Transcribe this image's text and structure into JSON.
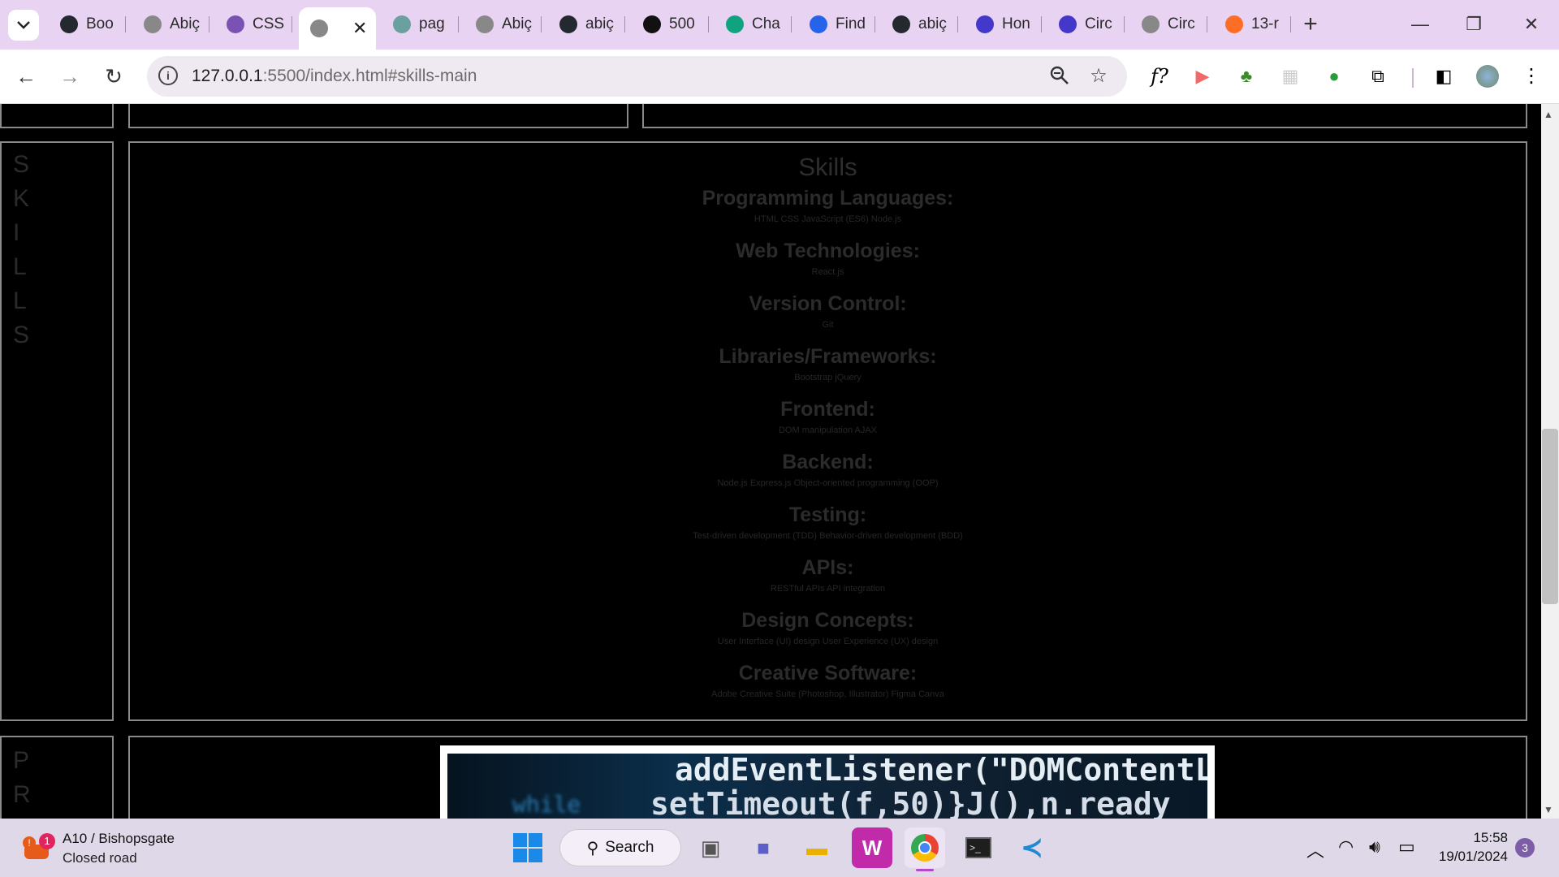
{
  "browser": {
    "tabs": [
      {
        "label": "Boo",
        "icon": "github-icon",
        "color": "#24292f"
      },
      {
        "label": "Abiç",
        "icon": "globe-icon",
        "color": "#888888"
      },
      {
        "label": "CSS",
        "icon": "bootstrap-icon",
        "color": "#7952b3"
      },
      {
        "label": "",
        "icon": "globe-icon",
        "color": "#888888",
        "active": true
      },
      {
        "label": "pag",
        "icon": "loading-icon",
        "color": "#6aa0a0"
      },
      {
        "label": "Abiç",
        "icon": "globe-icon",
        "color": "#888888"
      },
      {
        "label": "abiç",
        "icon": "github-icon",
        "color": "#24292f"
      },
      {
        "label": "500",
        "icon": "unsplash-icon",
        "color": "#111111"
      },
      {
        "label": "Cha",
        "icon": "chatgpt-icon",
        "color": "#10a37f"
      },
      {
        "label": "Find",
        "icon": "flag-icon",
        "color": "#2563eb"
      },
      {
        "label": "abiç",
        "icon": "github-icon",
        "color": "#24292f"
      },
      {
        "label": "Hon",
        "icon": "circle-c-icon",
        "color": "#4338ca"
      },
      {
        "label": "Circ",
        "icon": "circle-c-icon",
        "color": "#4338ca"
      },
      {
        "label": "Circ",
        "icon": "globe-icon",
        "color": "#888888"
      },
      {
        "label": "13-r",
        "icon": "gitlab-icon",
        "color": "#fc6d26"
      }
    ],
    "url_host": "127.0.0.1",
    "url_rest": ":5500/index.html#skills-main"
  },
  "page": {
    "side_letters_top": [
      "S",
      "K",
      "I",
      "L",
      "L",
      "S"
    ],
    "side_letters_bottom": [
      "P",
      "R"
    ],
    "skills": {
      "title": "Skills",
      "sections": [
        {
          "heading": "Programming Languages:",
          "items": "HTML CSS JavaScript (ES6) Node.js"
        },
        {
          "heading": "Web Technologies:",
          "items": "React.js"
        },
        {
          "heading": "Version Control:",
          "items": "Git"
        },
        {
          "heading": "Libraries/Frameworks:",
          "items": "Bootstrap jQuery"
        },
        {
          "heading": "Frontend:",
          "items": "DOM manipulation AJAX"
        },
        {
          "heading": "Backend:",
          "items": "Node.js Express.js Object-oriented programming (OOP)"
        },
        {
          "heading": "Testing:",
          "items": "Test-driven development (TDD) Behavior-driven development (BDD)"
        },
        {
          "heading": "APIs:",
          "items": "RESTful APIs API integration"
        },
        {
          "heading": "Design Concepts:",
          "items": "User Interface (UI) design User Experience (UX) design"
        },
        {
          "heading": "Creative Software:",
          "items": "Adobe Creative Suite (Photoshop, Illustrator) Figma Canva"
        }
      ]
    },
    "code_image": {
      "line1": "addEventListener(\"DOMContentLo",
      "line2": "setTimeout(f,50)}J(),n.ready"
    }
  },
  "taskbar": {
    "notification_count": "1",
    "traffic_title": "A10 / Bishopsgate",
    "traffic_status": "Closed road",
    "search_label": "Search",
    "time": "15:58",
    "date": "19/01/2024",
    "badge_count": "3"
  }
}
